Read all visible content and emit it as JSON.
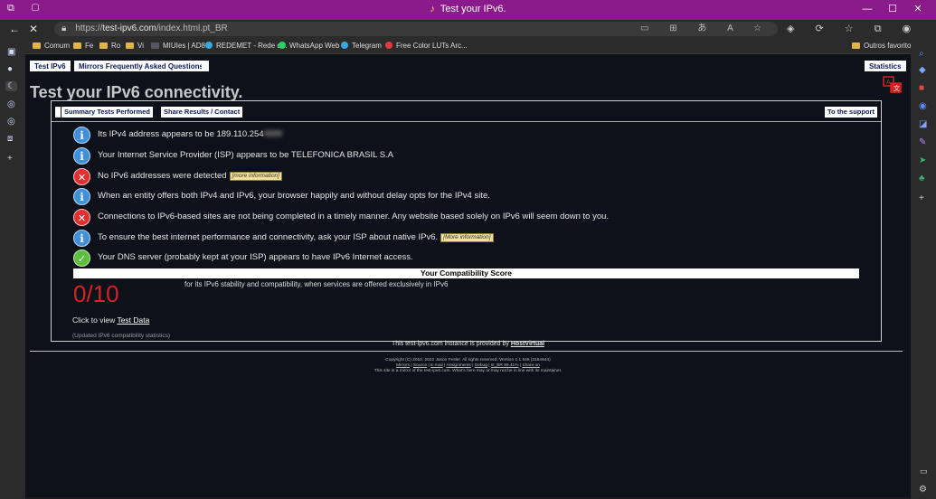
{
  "browser": {
    "window_title": "Test your IPv6.",
    "url_scheme": "https://",
    "url_host": "test-ipv6.com",
    "url_path": "/index.html.pt_BR",
    "bookmarks": [
      {
        "label": "Comum",
        "icon": "folder-icon"
      },
      {
        "label": "Fe",
        "icon": "folder-icon"
      },
      {
        "label": "Ro",
        "icon": "folder-icon"
      },
      {
        "label": "Vi",
        "icon": "folder-icon"
      },
      {
        "label": "MIUIes | AD8",
        "icon": "site-icon"
      },
      {
        "label": "REDEMET - Rede d...",
        "icon": "globe-icon"
      },
      {
        "label": "WhatsApp Web",
        "icon": "whatsapp-icon"
      },
      {
        "label": "Telegram",
        "icon": "telegram-icon"
      },
      {
        "label": "Free Color LUTs Arc...",
        "icon": "site-icon"
      }
    ],
    "other_favorites": "Outros favoritos"
  },
  "page": {
    "tabs": {
      "test": "Test IPv6",
      "mirrors": "Mirrors Frequently Asked Questions",
      "statistics": "Statistics"
    },
    "heading": "Test your IPv6 connectivity.",
    "inner_tabs": {
      "summary": "Summary Tests Performed",
      "share": "Share Results / Contact",
      "support": "To the support"
    },
    "results": [
      {
        "icon": "info",
        "text": "Its IPv4 address appears to be 189.110.254",
        "more": ""
      },
      {
        "icon": "info",
        "text": "Your Internet Service Provider (ISP) appears to be TELEFONICA BRASIL S.A",
        "more": ""
      },
      {
        "icon": "error",
        "text": "No IPv6 addresses were detected",
        "more": "[more information]"
      },
      {
        "icon": "info",
        "text": "When an entity offers both IPv4 and IPv6, your browser happily and without delay opts for the IPv4 site.",
        "more": ""
      },
      {
        "icon": "error",
        "text": "Connections to IPv6-based sites are not being completed in a timely manner. Any website based solely on IPv6 will seem down to you.",
        "more": ""
      },
      {
        "icon": "info",
        "text": "To ensure the best internet performance and connectivity, ask your ISP about native IPv6.",
        "more": "[More information]"
      },
      {
        "icon": "ok",
        "text": "Your DNS server (probably kept at your ISP) appears to have IPv6 Internet access.",
        "more": ""
      }
    ],
    "score_title": "Your Compatibility Score",
    "score": "0/10",
    "score_desc": "for its IPv6 stability and compatibility, when services are offered exclusively in IPv6",
    "test_data_prefix": "Click to view",
    "test_data_link": "Test Data",
    "updated": "(Updated IPv6 compatibility statistics)",
    "provided_prefix": "This test-ipv6.com instance is provided by",
    "provided_link": "HostVirtual",
    "footer_line1": "Copyright (C) 2010, 2022 Jason Fesler. All rights reserved. Version 1.1.949 (3184644)",
    "footer_links": [
      "Mirrors",
      "Source",
      "E-mail",
      "Assignments",
      "Debug",
      "st_BR 99.41%",
      "Share on"
    ],
    "footer_line3": "This site is a mirror of the test-ipv6.com. What's here may or may not be in line with its maintainer."
  },
  "colors": {
    "titlebar": "#8b1a8a",
    "page_bg": "#0e111a",
    "score": "#d42323",
    "info": "#3f90d8",
    "error": "#e0302f",
    "ok": "#5cbf3d"
  }
}
